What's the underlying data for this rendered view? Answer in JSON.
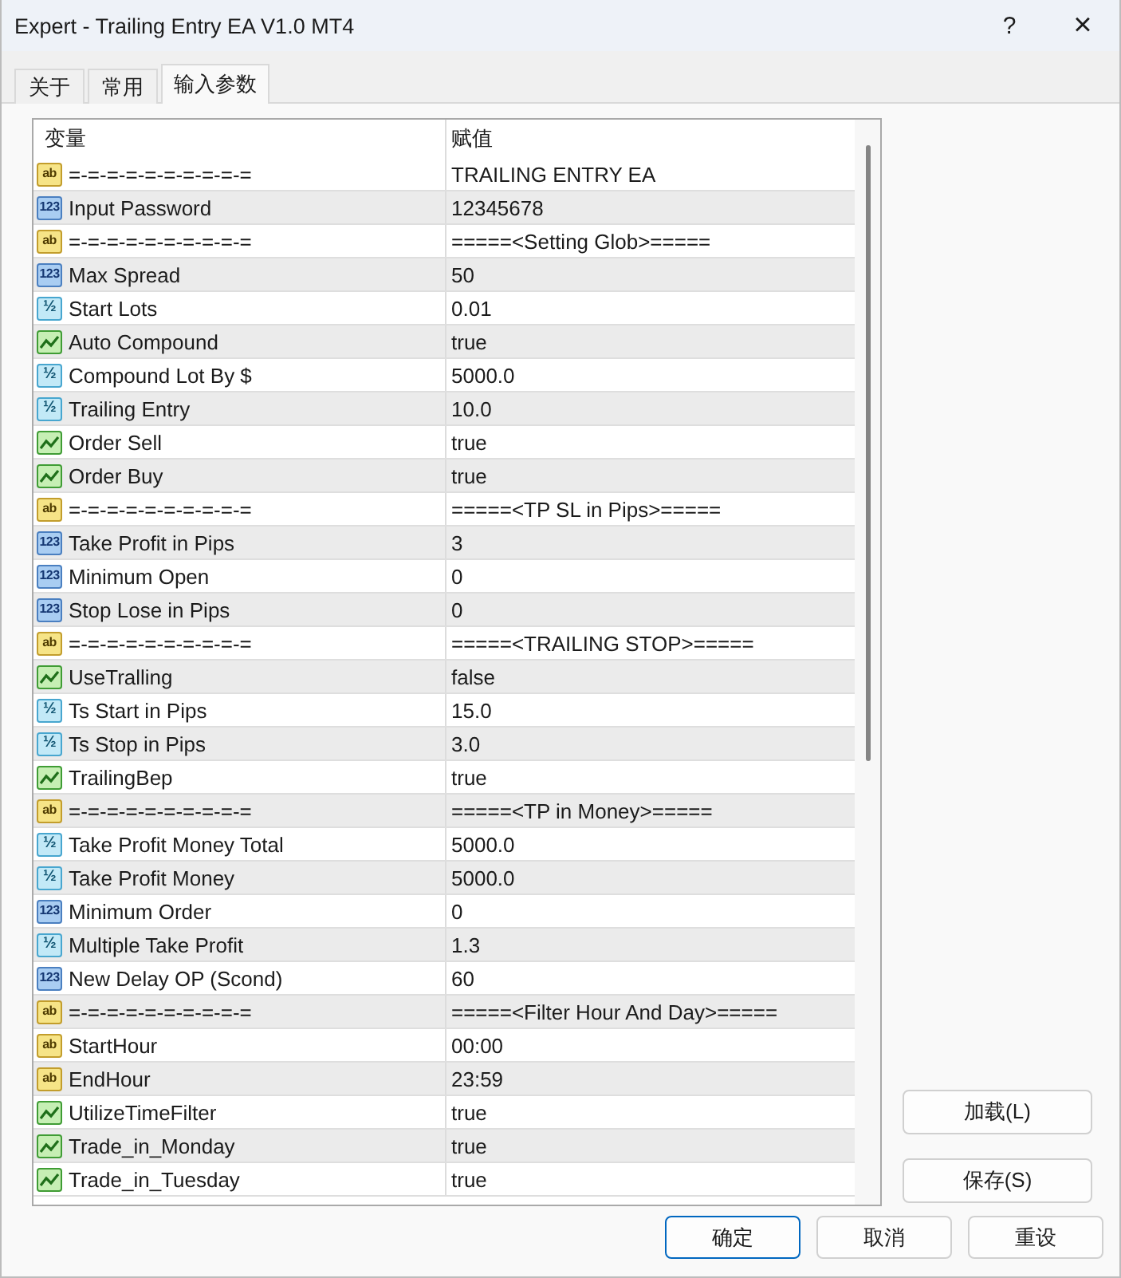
{
  "window": {
    "title": "Expert - Trailing Entry EA V1.0 MT4",
    "help_button": "?",
    "close_button": "×"
  },
  "tabs": [
    {
      "label": "关于",
      "selected": false
    },
    {
      "label": "常用",
      "selected": false
    },
    {
      "label": "输入参数",
      "selected": true
    }
  ],
  "table": {
    "columns": [
      "变量",
      "赋值"
    ],
    "rows": [
      {
        "kind": "string",
        "icon_label": "ab",
        "name": "=-=-=-=-=-=-=-=-=-=",
        "value": "TRAILING ENTRY EA"
      },
      {
        "kind": "int",
        "icon_label": "123",
        "name": "Input Password",
        "value": "12345678"
      },
      {
        "kind": "string",
        "icon_label": "ab",
        "name": "=-=-=-=-=-=-=-=-=-=",
        "value": "=====<Setting Glob>====="
      },
      {
        "kind": "int",
        "icon_label": "123",
        "name": "Max Spread",
        "value": "50"
      },
      {
        "kind": "double",
        "icon_label": "½",
        "name": "Start Lots",
        "value": "0.01"
      },
      {
        "kind": "bool",
        "name": "Auto Compound",
        "value": "true"
      },
      {
        "kind": "double",
        "icon_label": "½",
        "name": "Compound Lot By $",
        "value": "5000.0"
      },
      {
        "kind": "double",
        "icon_label": "½",
        "name": "Trailing Entry",
        "value": "10.0"
      },
      {
        "kind": "bool",
        "name": "Order Sell",
        "value": "true"
      },
      {
        "kind": "bool",
        "name": "Order Buy",
        "value": "true"
      },
      {
        "kind": "string",
        "icon_label": "ab",
        "name": "=-=-=-=-=-=-=-=-=-=",
        "value": "=====<TP SL in Pips>====="
      },
      {
        "kind": "int",
        "icon_label": "123",
        "name": "Take Profit in Pips",
        "value": "3"
      },
      {
        "kind": "int",
        "icon_label": "123",
        "name": "Minimum Open",
        "value": "0"
      },
      {
        "kind": "int",
        "icon_label": "123",
        "name": "Stop Lose in Pips",
        "value": "0"
      },
      {
        "kind": "string",
        "icon_label": "ab",
        "name": "=-=-=-=-=-=-=-=-=-=",
        "value": "=====<TRAILING STOP>====="
      },
      {
        "kind": "bool",
        "name": "UseTralling",
        "value": "false"
      },
      {
        "kind": "double",
        "icon_label": "½",
        "name": "Ts Start in Pips",
        "value": "15.0"
      },
      {
        "kind": "double",
        "icon_label": "½",
        "name": "Ts Stop in Pips",
        "value": "3.0"
      },
      {
        "kind": "bool",
        "name": "TrailingBep",
        "value": "true"
      },
      {
        "kind": "string",
        "icon_label": "ab",
        "name": "=-=-=-=-=-=-=-=-=-=",
        "value": "=====<TP in Money>====="
      },
      {
        "kind": "double",
        "icon_label": "½",
        "name": "Take Profit Money Total",
        "value": "5000.0"
      },
      {
        "kind": "double",
        "icon_label": "½",
        "name": "Take Profit Money",
        "value": "5000.0"
      },
      {
        "kind": "int",
        "icon_label": "123",
        "name": "Minimum Order",
        "value": "0"
      },
      {
        "kind": "double",
        "icon_label": "½",
        "name": "Multiple Take Profit",
        "value": "1.3"
      },
      {
        "kind": "int",
        "icon_label": "123",
        "name": "New Delay OP (Scond)",
        "value": "60"
      },
      {
        "kind": "string",
        "icon_label": "ab",
        "name": "=-=-=-=-=-=-=-=-=-=",
        "value": "=====<Filter Hour And Day>====="
      },
      {
        "kind": "string",
        "icon_label": "ab",
        "name": "StartHour",
        "value": "00:00"
      },
      {
        "kind": "string",
        "icon_label": "ab",
        "name": "EndHour",
        "value": "23:59"
      },
      {
        "kind": "bool",
        "name": "UtilizeTimeFilter",
        "value": "true"
      },
      {
        "kind": "bool",
        "name": "Trade_in_Monday",
        "value": "true"
      },
      {
        "kind": "bool",
        "name": "Trade_in_Tuesday",
        "value": "true"
      }
    ]
  },
  "side_buttons": [
    "加载(L)",
    "保存(S)"
  ],
  "buttons": [
    {
      "label": "确定",
      "default": true
    },
    {
      "label": "取消",
      "default": false
    },
    {
      "label": "重设",
      "default": false
    }
  ]
}
